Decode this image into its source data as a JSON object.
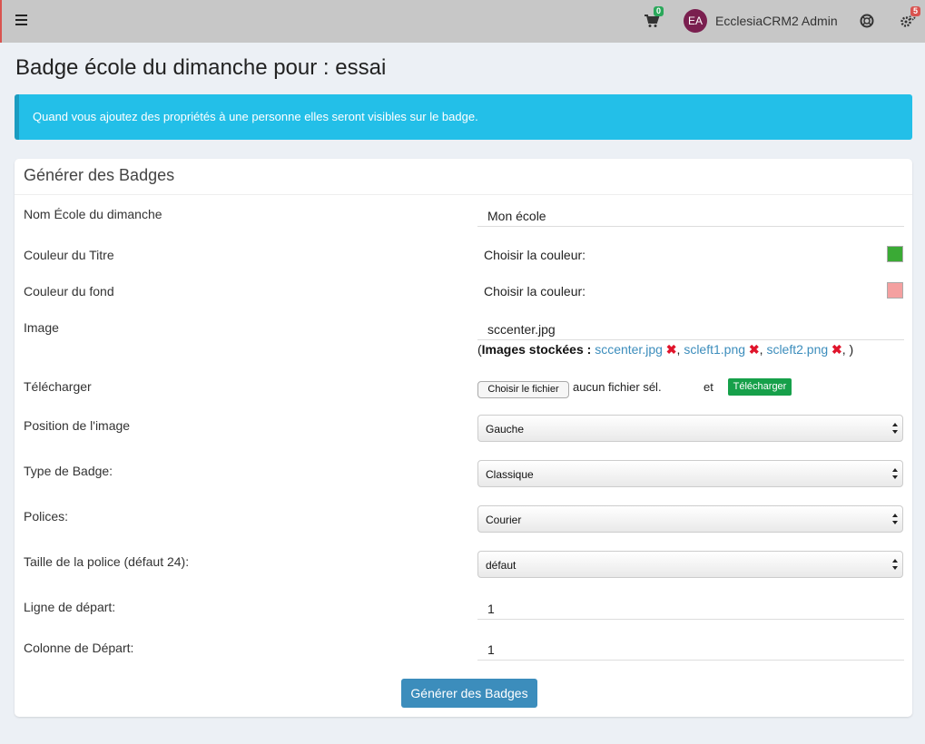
{
  "topbar": {
    "cart_count": "0",
    "avatar_initials": "EA",
    "username": "EcclesiaCRM2 Admin",
    "settings_count": "5",
    "icons": [
      "hamburger-icon",
      "cart-icon",
      "help-icon",
      "gear-icon"
    ]
  },
  "page": {
    "title": "Badge école du dimanche pour : essai"
  },
  "callout": {
    "text": "Quand vous ajoutez des propriétés à une personne elles seront visibles sur le badge."
  },
  "card": {
    "title": "Générer des Badges",
    "fields": {
      "school_name": {
        "label": "Nom École du dimanche",
        "value": "Mon école"
      },
      "title_color": {
        "label": "Couleur du Titre",
        "picker_label": "Choisir la couleur:",
        "color": "#3aaa35"
      },
      "bg_color": {
        "label": "Couleur du fond",
        "picker_label": "Choisir la couleur:",
        "color": "#f4a0a0"
      },
      "image": {
        "label": "Image",
        "value": "sccenter.jpg"
      },
      "stored": {
        "prefix": "(",
        "heading": "Images stockées :",
        "files": [
          "sccenter.jpg",
          "scleft1.png",
          "scleft2.png"
        ],
        "sep": ",",
        "suffix": ", )"
      },
      "upload": {
        "label": "Télécharger",
        "choose_button": "Choisir le fichier",
        "no_file": "aucun fichier sél.",
        "and": "et",
        "upload_button": "Télécharger"
      },
      "image_position": {
        "label": "Position de l'image",
        "value": "Gauche"
      },
      "badge_type": {
        "label": "Type de Badge:",
        "value": "Classique"
      },
      "fonts": {
        "label": "Polices:",
        "value": "Courier"
      },
      "font_size": {
        "label": "Taille de la police (défaut 24):",
        "value": "défaut"
      },
      "start_row": {
        "label": "Ligne de départ:",
        "value": "1"
      },
      "start_col": {
        "label": "Colonne de Départ:",
        "value": "1"
      }
    },
    "submit_label": "Générer des Badges"
  }
}
